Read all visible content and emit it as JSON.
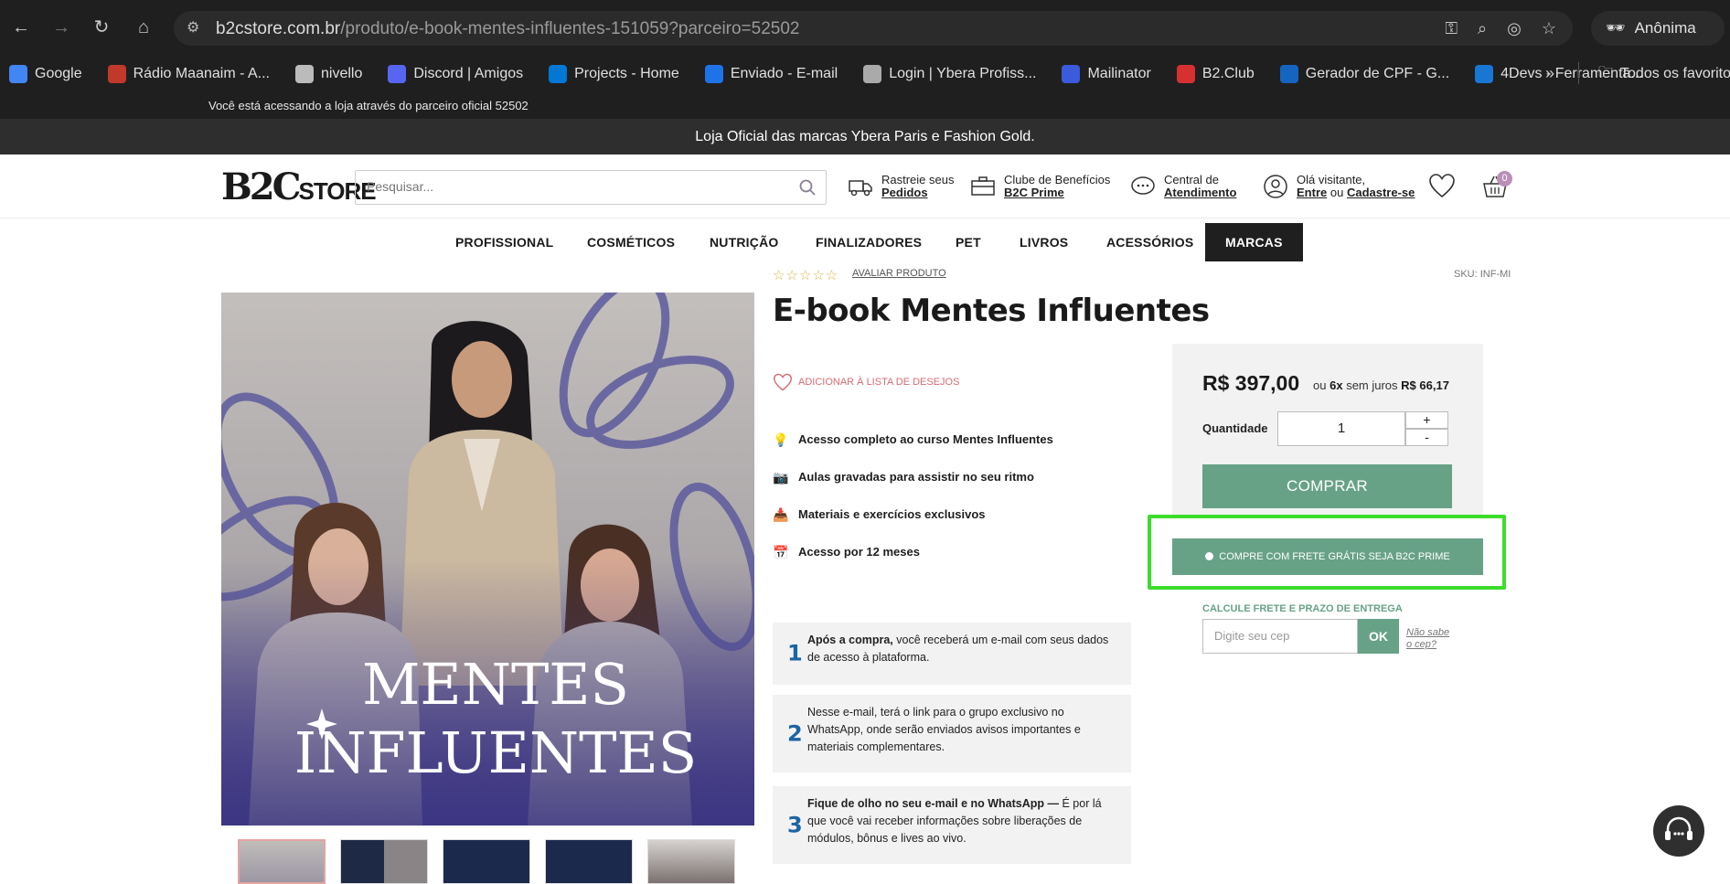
{
  "browser": {
    "url_host": "b2cstore.com.br",
    "url_path": "/produto/e-book-mentes-influentes-151059?parceiro=52502",
    "profile_label": "Anônima",
    "bookmarks": [
      {
        "label": "Google",
        "icon": "google-icon",
        "color": "#4285f4"
      },
      {
        "label": "Rádio Maanaim - A...",
        "icon": "radio-icon",
        "color": "#c0392b"
      },
      {
        "label": "nivello",
        "icon": "folder-icon",
        "color": "#bbbbbb"
      },
      {
        "label": "Discord | Amigos",
        "icon": "discord-icon",
        "color": "#5865f2"
      },
      {
        "label": "Projects - Home",
        "icon": "azure-devops-icon",
        "color": "#0078d4"
      },
      {
        "label": "Enviado - E-mail",
        "icon": "mail-icon",
        "color": "#1e73e8"
      },
      {
        "label": "Login | Ybera Profiss...",
        "icon": "globe-icon",
        "color": "#aaaaaa"
      },
      {
        "label": "Mailinator",
        "icon": "mailinator-icon",
        "color": "#3b5bdb"
      },
      {
        "label": "B2.Club",
        "icon": "b2club-icon",
        "color": "#d63031"
      },
      {
        "label": "Gerador de CPF - G...",
        "icon": "nv-icon",
        "color": "#1565c0"
      },
      {
        "label": "4Devs - Ferramenta...",
        "icon": "4devs-icon",
        "color": "#1976d2"
      }
    ],
    "bookmarks_more": "»",
    "all_bookmarks": "Todos os favoritos"
  },
  "site": {
    "partner_notice": "Você está acessando a loja através do parceiro oficial 52502",
    "top_banner": "Loja Oficial das marcas Ybera Paris e Fashion Gold.",
    "logo_b2c": "B2C",
    "logo_store": "STORE",
    "search_placeholder": "Pesquisar...",
    "header_links": {
      "orders_line1": "Rastreie seus",
      "orders_line2": "Pedidos",
      "club_line1": "Clube de Benefícios",
      "club_line2": "B2C Prime",
      "support_line1": "Central de",
      "support_line2": "Atendimento",
      "account_line1": "Olá visitante,",
      "account_enter": "Entre",
      "account_or": "ou",
      "account_signup": "Cadastre-se"
    },
    "cart_count": "0",
    "menu": [
      "PROFISSIONAL",
      "COSMÉTICOS",
      "NUTRIÇÃO",
      "FINALIZADORES",
      "PET",
      "LIVROS",
      "ACESSÓRIOS",
      "MARCAS"
    ]
  },
  "product": {
    "rate_link": "AVALIAR PRODUTO",
    "rating_stars": 0,
    "sku": "SKU: INF-MI",
    "title": "E-book Mentes Influentes",
    "image_text_line1": "MENTES",
    "image_text_line2": "INFLUENTES",
    "wishlist": "ADICIONAR À LISTA DE DESEJOS",
    "features": [
      {
        "icon": "lightbulb-icon",
        "glyph": "💡",
        "text": "Acesso completo ao curso Mentes Influentes"
      },
      {
        "icon": "camera-icon",
        "glyph": "📷",
        "text": "Aulas gravadas para assistir no seu ritmo"
      },
      {
        "icon": "inbox-icon",
        "glyph": "📥",
        "text": "Materiais e exercícios exclusivos"
      },
      {
        "icon": "calendar-icon",
        "glyph": "📅",
        "text": "Acesso por 12 meses"
      }
    ],
    "steps": [
      {
        "num": "1",
        "bold": "Após a compra,",
        "text": " você receberá um e-mail com seus dados de acesso à plataforma."
      },
      {
        "num": "2",
        "bold": "",
        "text": "Nesse e-mail, terá o link para o grupo exclusivo no WhatsApp, onde serão enviados avisos importantes e materiais complementares."
      },
      {
        "num": "3",
        "bold": "Fique de olho no seu e-mail e no WhatsApp —",
        "text": " É por lá que você vai receber informações sobre liberações de módulos, bônus e lives ao vivo."
      }
    ],
    "price": "R$ 397,00",
    "inst_prefix": "ou",
    "inst_count": "6x",
    "inst_mid": "sem juros",
    "inst_value": "R$ 66,17",
    "qty_label": "Quantidade",
    "qty_value": "1",
    "qty_plus": "+",
    "qty_minus": "-",
    "buy_label": "COMPRAR",
    "prime_label": "COMPRE COM FRETE GRÁTIS SEJA B2C PRIME",
    "shipping_title": "CALCULE FRETE E PRAZO DE ENTREGA",
    "cep_placeholder": "Digite seu cep",
    "cep_ok": "OK",
    "cep_help_1": "Não sabe",
    "cep_help_2": "o cep?"
  },
  "colors": {
    "accent": "#67a287",
    "highlight": "#3cdd2a",
    "dark": "#2e2e2e",
    "step_number": "#1c64a4"
  }
}
